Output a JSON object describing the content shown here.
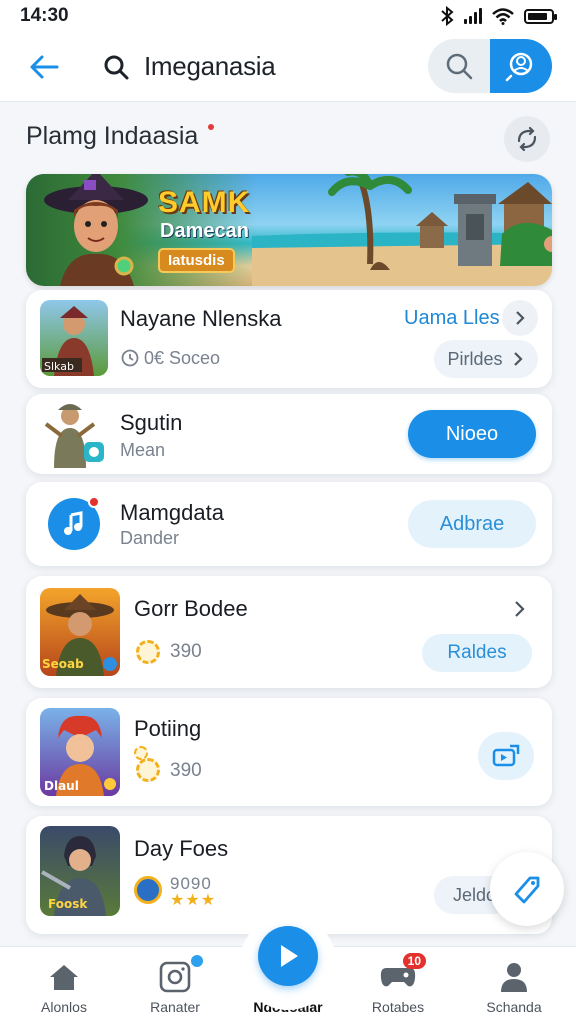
{
  "status_bar": {
    "time": "14:30",
    "battery_level": 0.85
  },
  "header": {
    "title": "Imeganasia"
  },
  "section": {
    "title": "Plamg Indaasia"
  },
  "banner": {
    "title": "SAMK",
    "subtitle": "Damecan",
    "tag": "Iatusdis"
  },
  "cards": [
    {
      "title": "Nayane Nlenska",
      "meta": "0€ Soceo",
      "link": "Uama Lles",
      "action": "Pirldes"
    },
    {
      "title": "Sgutin",
      "sub": "Mean",
      "action": "Nioeo"
    },
    {
      "title": "Mamgdata",
      "sub": "Dander",
      "action": "Adbrae"
    },
    {
      "title": "Gorr Bodee",
      "coins": "390",
      "action": "Raldes"
    },
    {
      "title": "Potiing",
      "coins": "390"
    },
    {
      "title": "Day Foes",
      "coins": "9090",
      "action": "Jeldc"
    }
  ],
  "bottom_nav": {
    "items": [
      {
        "label": "Alonlos",
        "icon": "home-icon"
      },
      {
        "label": "Ranater",
        "icon": "instagram-icon"
      },
      {
        "label": "Ndodoaiar",
        "icon": "play-icon"
      },
      {
        "label": "Rotabes",
        "icon": "gamepad-icon",
        "badge": "10"
      },
      {
        "label": "Schanda",
        "icon": "person-icon"
      }
    ]
  },
  "colors": {
    "accent": "#1b8fe8",
    "background": "#f4f6f9",
    "badge": "#e3312e"
  }
}
